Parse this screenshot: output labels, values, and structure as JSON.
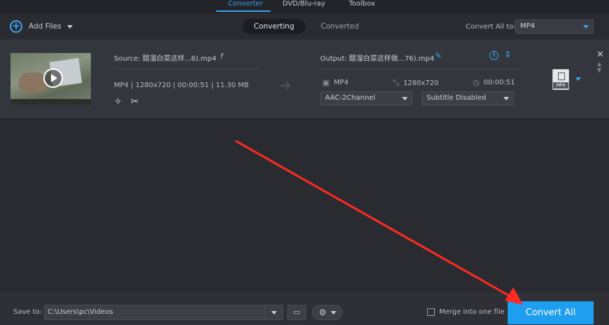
{
  "top_tabs": {
    "converter": "Converter",
    "dvd": "DVD/Blu-ray",
    "toolbox": "Toolbox"
  },
  "toolbar": {
    "add_files": "Add Files",
    "seg_converting": "Converting",
    "seg_converted": "Converted",
    "convert_all_to": "Convert All to:",
    "format_value": "MP4"
  },
  "file": {
    "source_name": "Source: 醋溜白菜这样...6).mp4",
    "source_meta": "MP4 | 1280x720 | 00:00:51 | 11.30 MB",
    "output_name": "Output: 醋溜白菜这样做...76).mp4",
    "out_format": "MP4",
    "out_resolution": "1280x720",
    "out_duration": "00:00:51",
    "audio_track": "AAC-2Channel",
    "subtitle": "Subtitle Disabled",
    "badge_label": "MP4"
  },
  "bottom": {
    "save_to": "Save to:",
    "path": "C:\\Users\\pc\\Videos",
    "merge_label": "Merge into one file",
    "convert_all": "Convert All"
  },
  "colors": {
    "accent": "#1e9ef0",
    "tab_active": "#3aa3ee",
    "annotation": "#ff2a22"
  }
}
